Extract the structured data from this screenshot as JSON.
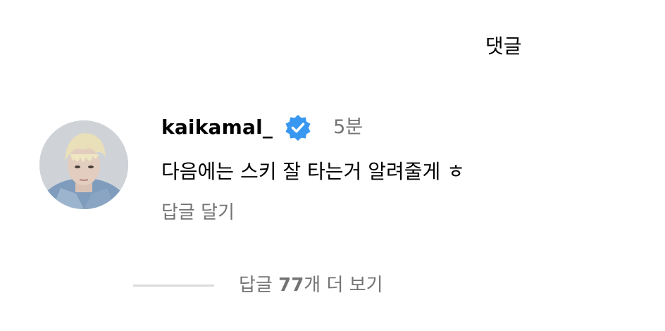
{
  "sheet": {
    "title": "댓글"
  },
  "comment": {
    "username": "kaikamal_",
    "verified_icon": "verified-badge-icon",
    "verified_color": "#3897f0",
    "timestamp": "5분",
    "text": "다음에는 스키 잘 타는거 알려줄게 ㅎ",
    "reply_label": "답글 달기"
  },
  "view_replies": {
    "prefix": "답글 ",
    "count": "77",
    "suffix": "개 더 보기"
  }
}
